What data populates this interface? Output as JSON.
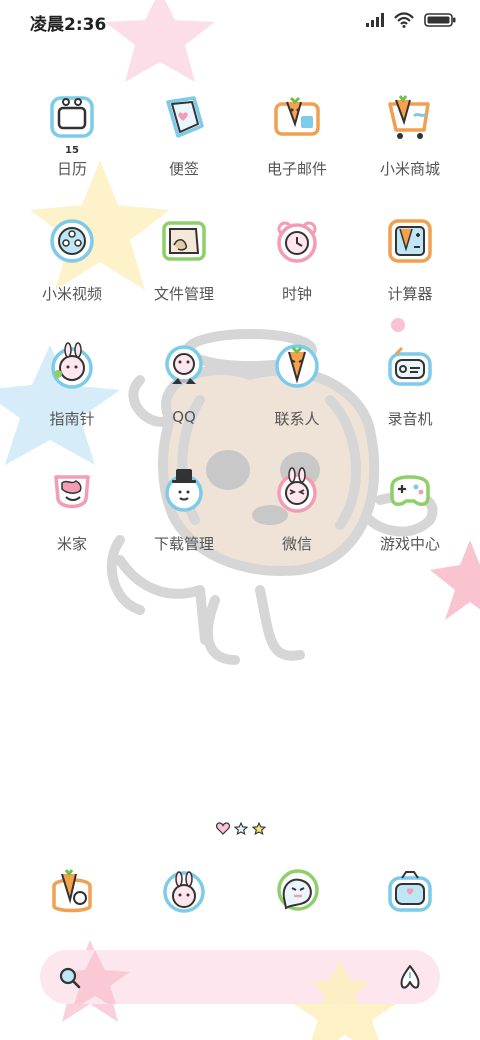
{
  "status_bar": {
    "time": "凌晨2:36",
    "icons": [
      "signal-icon",
      "wifi-icon",
      "battery-icon"
    ]
  },
  "apps": [
    {
      "label": "日历",
      "icon": "calendar-icon",
      "badge": "15"
    },
    {
      "label": "便签",
      "icon": "notes-icon"
    },
    {
      "label": "电子邮件",
      "icon": "email-icon"
    },
    {
      "label": "小米商城",
      "icon": "mi-store-icon"
    },
    {
      "label": "小米视频",
      "icon": "video-icon"
    },
    {
      "label": "文件管理",
      "icon": "file-manager-icon"
    },
    {
      "label": "时钟",
      "icon": "clock-icon"
    },
    {
      "label": "计算器",
      "icon": "calculator-icon"
    },
    {
      "label": "指南针",
      "icon": "compass-icon"
    },
    {
      "label": "QQ",
      "icon": "qq-icon"
    },
    {
      "label": "联系人",
      "icon": "contacts-icon"
    },
    {
      "label": "录音机",
      "icon": "recorder-icon"
    },
    {
      "label": "米家",
      "icon": "mijia-icon"
    },
    {
      "label": "下载管理",
      "icon": "download-manager-icon"
    },
    {
      "label": "微信",
      "icon": "wechat-icon"
    },
    {
      "label": "游戏中心",
      "icon": "game-center-icon"
    }
  ],
  "dock": [
    {
      "icon": "phone-icon"
    },
    {
      "icon": "messages-icon"
    },
    {
      "icon": "chat-icon"
    },
    {
      "icon": "camera-icon"
    }
  ],
  "page_indicator": [
    "heart-icon",
    "star-icon",
    "star-icon"
  ],
  "search": {
    "icons": [
      "search-icon",
      "assistant-icon"
    ]
  },
  "colors": {
    "blue_outline": "#7ccbe8",
    "orange_outline": "#f0a050",
    "green_outline": "#8fcf6a",
    "pink_outline": "#f49cb3",
    "search_bg": "#fde6ee"
  }
}
